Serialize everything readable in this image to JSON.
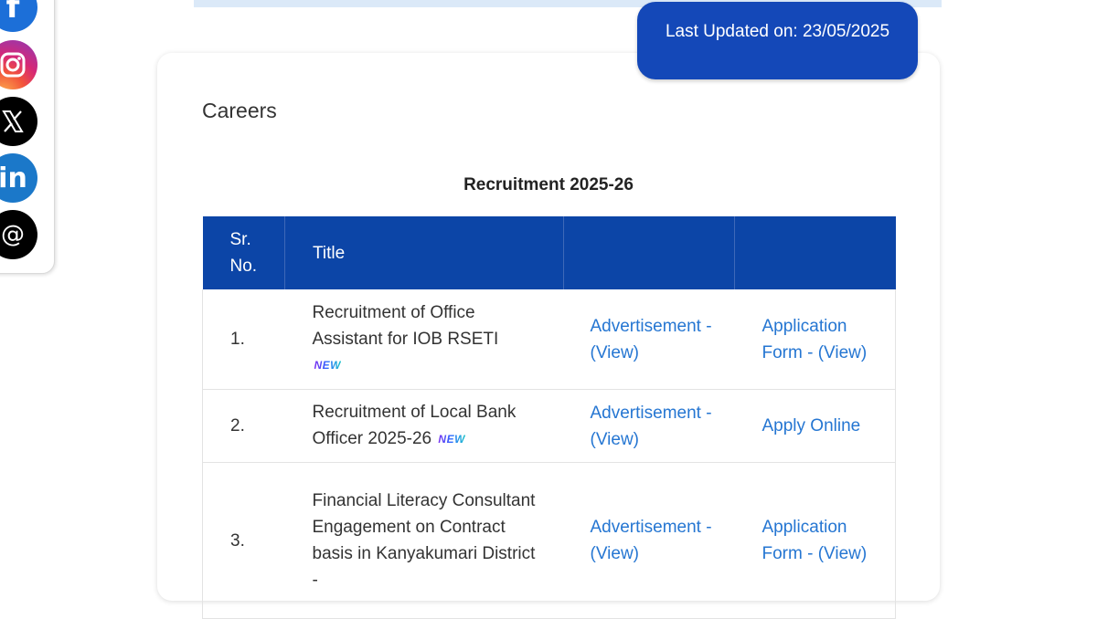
{
  "social": [
    {
      "name": "facebook",
      "icon": "facebook-icon",
      "glyph": "f"
    },
    {
      "name": "instagram",
      "icon": "instagram-icon",
      "glyph": ""
    },
    {
      "name": "x",
      "icon": "x-icon",
      "glyph": "𝕏"
    },
    {
      "name": "linkedin",
      "icon": "linkedin-icon",
      "glyph": "in"
    },
    {
      "name": "threads",
      "icon": "threads-icon",
      "glyph": "@"
    }
  ],
  "header": {
    "last_updated": "Last Updated on: 23/05/2025"
  },
  "page": {
    "title": "Careers",
    "caption": "Recruitment 2025-26"
  },
  "table": {
    "headers": {
      "sr": "Sr.\nNo.",
      "title": "Title",
      "adv": "",
      "app": ""
    },
    "new_badge": "NEW",
    "rows": [
      {
        "sr": "1.",
        "title": "Recruitment of Office Assistant for IOB RSETI",
        "new": true,
        "adv": "Advertisement - (View)",
        "app": "Application Form - (View)"
      },
      {
        "sr": "2.",
        "title": "Recruitment of Local Bank Officer 2025-26",
        "new": true,
        "adv": "Advertisement - (View)",
        "app": "Apply Online"
      },
      {
        "sr": "3.",
        "title": "Financial Literacy Consultant Engagement on Contract basis in Kanyakumari District -",
        "new": false,
        "adv": "Advertisement - (View)",
        "app": "Application Form - (View)"
      }
    ]
  },
  "colors": {
    "brand_blue": "#0c45a7",
    "badge_blue": "#1448b8",
    "link_blue": "#2576d2"
  }
}
